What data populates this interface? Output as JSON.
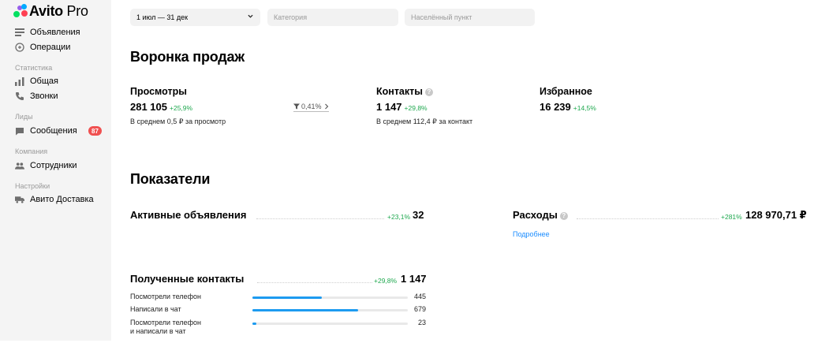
{
  "app": {
    "logo_brand": "Avito",
    "logo_suffix": "Pro"
  },
  "sidebar": {
    "items_top": [
      {
        "label": "Объявления",
        "icon": "listing-icon"
      },
      {
        "label": "Операции",
        "icon": "operations-icon"
      }
    ],
    "sections": [
      {
        "title": "Статистика",
        "items": [
          {
            "label": "Общая",
            "icon": "bar-chart-icon"
          },
          {
            "label": "Звонки",
            "icon": "phone-icon"
          }
        ]
      },
      {
        "title": "Лиды",
        "items": [
          {
            "label": "Сообщения",
            "icon": "message-icon",
            "badge": "87"
          }
        ]
      },
      {
        "title": "Компания",
        "items": [
          {
            "label": "Сотрудники",
            "icon": "employees-icon"
          }
        ]
      },
      {
        "title": "Настройки",
        "items": [
          {
            "label": "Авито Доставка",
            "icon": "delivery-truck-icon"
          }
        ]
      }
    ]
  },
  "filters": {
    "period": "1 июл — 31 дек",
    "category_placeholder": "Категория",
    "location_placeholder": "Населённый пункт"
  },
  "funnel": {
    "title": "Воронка продаж",
    "views": {
      "title": "Просмотры",
      "value": "281 105",
      "delta": "+25,9%",
      "sub": "В среднем 0,5 ₽ за просмотр"
    },
    "conversion": "0,41%",
    "contacts": {
      "title": "Контакты",
      "value": "1 147",
      "delta": "+29,8%",
      "sub": "В среднем 112,4 ₽ за контакт"
    },
    "favorites": {
      "title": "Избранное",
      "value": "16 239",
      "delta": "+14,5%"
    }
  },
  "indicators": {
    "title": "Показатели",
    "active_ads": {
      "label": "Активные объявления",
      "delta": "+23,1%",
      "value": "32"
    },
    "expenses": {
      "label": "Расходы",
      "delta": "+281%",
      "value": "128 970,71 ₽",
      "link": "Подробнее"
    },
    "contacts": {
      "label": "Полученные контакты",
      "delta": "+29,8%",
      "value": "1 147",
      "rows": [
        {
          "label": "Посмотрели телефон",
          "value": "445",
          "fill": 0.445
        },
        {
          "label": "Написали в чат",
          "value": "679",
          "fill": 0.679
        },
        {
          "label": "Посмотрели телефон\nи написали в чат",
          "value": "23",
          "fill": 0.023
        }
      ]
    }
  },
  "colors": {
    "accent_blue": "#1d9bf0",
    "positive_green": "#1fa84f",
    "badge_red": "#f05050",
    "sidebar_bg": "#f4f4f4"
  }
}
